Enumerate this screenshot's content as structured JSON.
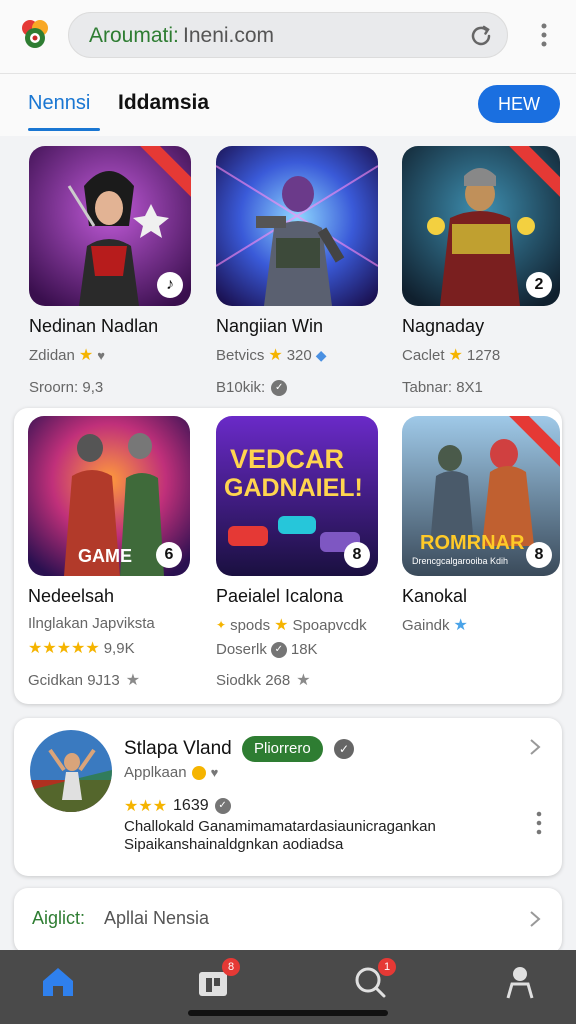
{
  "browser": {
    "url_scheme": "Aroumati:",
    "url_rest": "Ineni.com"
  },
  "tabs": {
    "active": "Nennsi",
    "secondary": "Iddamsia",
    "new_button": "HEW"
  },
  "games_row1": [
    {
      "title": "Nedinan Nadlan",
      "sub": "Zdidan",
      "meta": "Sroorn: 9,3",
      "badge": "♪"
    },
    {
      "title": "Nangiian Win",
      "sub": "Betvics",
      "sub_value": "320",
      "meta": "B10kik:",
      "badge": ""
    },
    {
      "title": "Nagnaday",
      "sub": "Caclet",
      "sub_value": "1278",
      "meta": "Tabnar: 8X1",
      "badge": "2"
    }
  ],
  "games_row2": [
    {
      "title": "Nedeelsah",
      "sub": "Ilnglakan Japviksta",
      "rating": "9,9K",
      "meta": "Gcidkan 9J13",
      "badge": "6",
      "art_text": "GAME"
    },
    {
      "title": "Paeialel Icalona",
      "sub": "spods",
      "sub_value": "Spoapvcdk",
      "dev": "Doserlk",
      "dev_value": "18K",
      "meta": "Siodkk 268",
      "badge": "8",
      "art_title_1": "VEDCAR",
      "art_title_2": "GADNAIEL!"
    },
    {
      "title": "Kanokal",
      "sub": "Gaindk",
      "badge": "8",
      "art_text": "ROMRNAR",
      "art_sub": "Drencgcalgarooiba Kdih"
    }
  ],
  "featured_app": {
    "name": "Stlapa Vland",
    "badge": "Pliorrero",
    "developer": "Applkaan",
    "rating": "1639",
    "description": "Challokald Ganamimamatardasiaunicragankan Sipaikanshainaldgnkan aodiadsa"
  },
  "section": {
    "link": "Aiglict:",
    "text": "Apllai Nensia"
  },
  "bottom_nav": {
    "library_badge": "8",
    "search_badge": "1"
  },
  "colors": {
    "accent_blue": "#1a6fe0",
    "accent_green": "#2e7d32",
    "star": "#f5b400",
    "nav_bg": "#4a4a4a"
  }
}
